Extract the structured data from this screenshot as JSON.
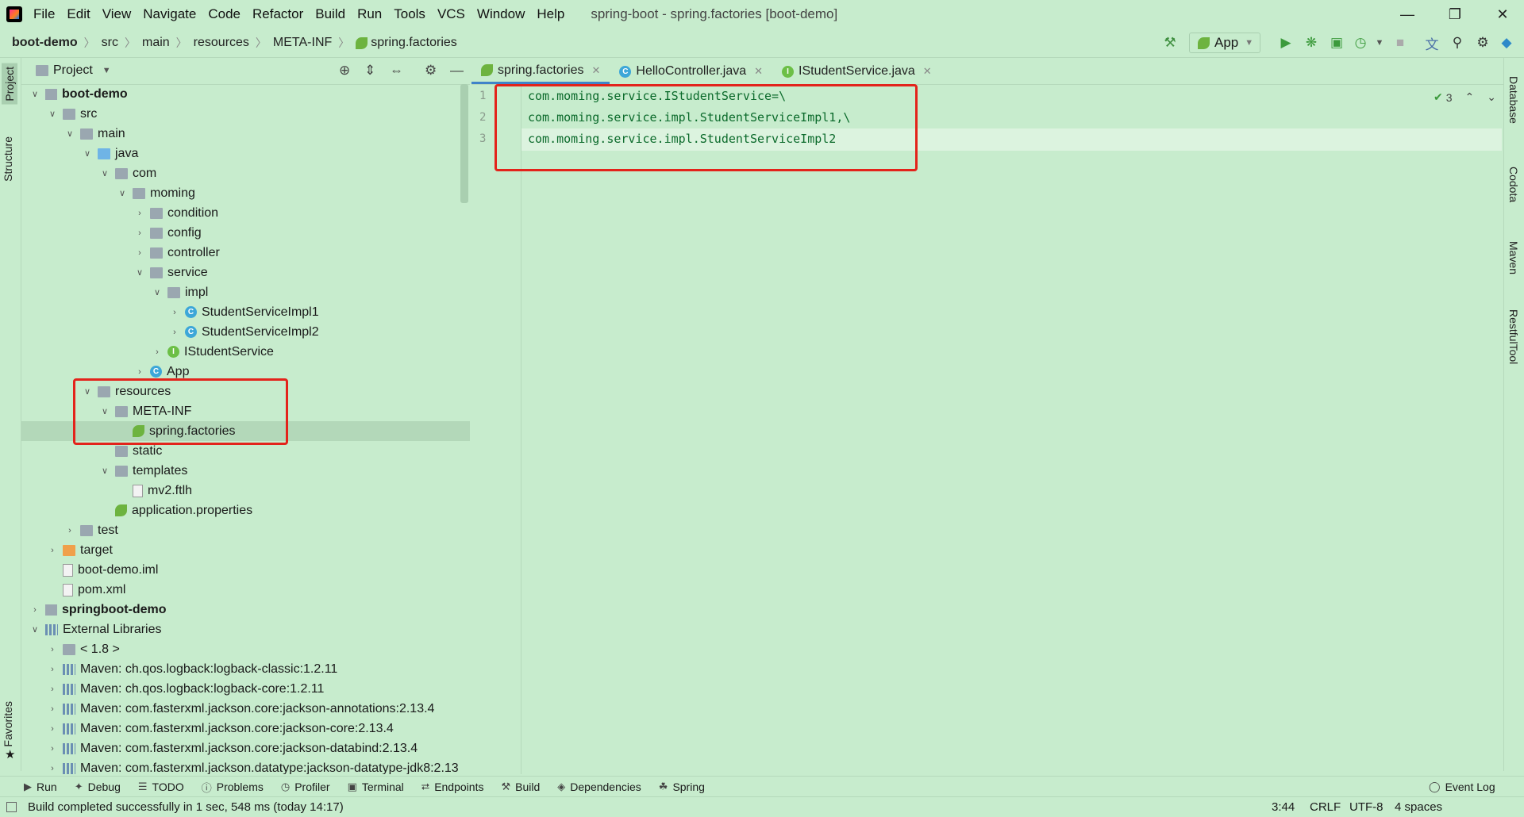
{
  "window": {
    "menu": [
      "File",
      "Edit",
      "View",
      "Navigate",
      "Code",
      "Refactor",
      "Build",
      "Run",
      "Tools",
      "VCS",
      "Window",
      "Help"
    ],
    "title": "spring-boot - spring.factories [boot-demo]"
  },
  "breadcrumb": [
    "boot-demo",
    "src",
    "main",
    "resources",
    "META-INF",
    "spring.factories"
  ],
  "toolbar": {
    "run_config": "App"
  },
  "left_stripe": {
    "project": "Project",
    "structure": "Structure",
    "favorites": "Favorites"
  },
  "right_stripe": {
    "database": "Database",
    "codota": "Codota",
    "maven": "Maven",
    "restful": "RestfulTool"
  },
  "project_panel": {
    "title": "Project"
  },
  "tree": [
    {
      "label": "boot-demo",
      "depth": 0,
      "chev": "v",
      "icon": "mod",
      "bold": true
    },
    {
      "label": "src",
      "depth": 1,
      "chev": "v",
      "icon": "folder"
    },
    {
      "label": "main",
      "depth": 2,
      "chev": "v",
      "icon": "folder"
    },
    {
      "label": "java",
      "depth": 3,
      "chev": "v",
      "icon": "folder blue"
    },
    {
      "label": "com",
      "depth": 4,
      "chev": "v",
      "icon": "folder"
    },
    {
      "label": "moming",
      "depth": 5,
      "chev": "v",
      "icon": "folder"
    },
    {
      "label": "condition",
      "depth": 6,
      "chev": ">",
      "icon": "folder"
    },
    {
      "label": "config",
      "depth": 6,
      "chev": ">",
      "icon": "folder"
    },
    {
      "label": "controller",
      "depth": 6,
      "chev": ">",
      "icon": "folder"
    },
    {
      "label": "service",
      "depth": 6,
      "chev": "v",
      "icon": "folder"
    },
    {
      "label": "impl",
      "depth": 7,
      "chev": "v",
      "icon": "folder"
    },
    {
      "label": "StudentServiceImpl1",
      "depth": 8,
      "chev": ">",
      "icon": "cls"
    },
    {
      "label": "StudentServiceImpl2",
      "depth": 8,
      "chev": ">",
      "icon": "cls"
    },
    {
      "label": "IStudentService",
      "depth": 7,
      "chev": ">",
      "icon": "iface"
    },
    {
      "label": "App",
      "depth": 6,
      "chev": ">",
      "icon": "cls"
    },
    {
      "label": "resources",
      "depth": 3,
      "chev": "v",
      "icon": "folder res"
    },
    {
      "label": "META-INF",
      "depth": 4,
      "chev": "v",
      "icon": "folder"
    },
    {
      "label": "spring.factories",
      "depth": 5,
      "chev": "",
      "icon": "spring",
      "selected": true
    },
    {
      "label": "static",
      "depth": 4,
      "chev": "",
      "icon": "folder"
    },
    {
      "label": "templates",
      "depth": 4,
      "chev": "v",
      "icon": "folder"
    },
    {
      "label": "mv2.ftlh",
      "depth": 5,
      "chev": "",
      "icon": "file"
    },
    {
      "label": "application.properties",
      "depth": 4,
      "chev": "",
      "icon": "spring"
    },
    {
      "label": "test",
      "depth": 2,
      "chev": ">",
      "icon": "folder"
    },
    {
      "label": "target",
      "depth": 1,
      "chev": ">",
      "icon": "folder orange"
    },
    {
      "label": "boot-demo.iml",
      "depth": 1,
      "chev": "",
      "icon": "file"
    },
    {
      "label": "pom.xml",
      "depth": 1,
      "chev": "",
      "icon": "file"
    },
    {
      "label": "springboot-demo",
      "depth": 0,
      "chev": ">",
      "icon": "mod",
      "bold": true
    },
    {
      "label": "External Libraries",
      "depth": 0,
      "chev": "v",
      "icon": "lib"
    },
    {
      "label": "< 1.8 >",
      "depth": 1,
      "chev": ">",
      "icon": "folder"
    },
    {
      "label": "Maven: ch.qos.logback:logback-classic:1.2.11",
      "depth": 1,
      "chev": ">",
      "icon": "lib"
    },
    {
      "label": "Maven: ch.qos.logback:logback-core:1.2.11",
      "depth": 1,
      "chev": ">",
      "icon": "lib"
    },
    {
      "label": "Maven: com.fasterxml.jackson.core:jackson-annotations:2.13.4",
      "depth": 1,
      "chev": ">",
      "icon": "lib"
    },
    {
      "label": "Maven: com.fasterxml.jackson.core:jackson-core:2.13.4",
      "depth": 1,
      "chev": ">",
      "icon": "lib"
    },
    {
      "label": "Maven: com.fasterxml.jackson.core:jackson-databind:2.13.4",
      "depth": 1,
      "chev": ">",
      "icon": "lib"
    },
    {
      "label": "Maven: com.fasterxml.jackson.datatype:jackson-datatype-jdk8:2.13",
      "depth": 1,
      "chev": ">",
      "icon": "lib"
    }
  ],
  "editor_tabs": [
    {
      "label": "spring.factories",
      "icon": "spring",
      "active": true
    },
    {
      "label": "HelloController.java",
      "icon": "cls"
    },
    {
      "label": "IStudentService.java",
      "icon": "iface"
    }
  ],
  "editor": {
    "lines": [
      "com.moming.service.IStudentService=\\",
      "com.moming.service.impl.StudentServiceImpl1,\\",
      "com.moming.service.impl.StudentServiceImpl2"
    ],
    "line_numbers": [
      "1",
      "2",
      "3"
    ],
    "inspection_count": "3"
  },
  "bottom_tools": [
    "Run",
    "Debug",
    "TODO",
    "Problems",
    "Profiler",
    "Terminal",
    "Endpoints",
    "Build",
    "Dependencies",
    "Spring"
  ],
  "event_log": "Event Log",
  "status": {
    "message": "Build completed successfully in 1 sec, 548 ms (today 14:17)",
    "position": "3:44",
    "line_sep": "CRLF",
    "encoding": "UTF-8",
    "indent": "4 spaces"
  }
}
